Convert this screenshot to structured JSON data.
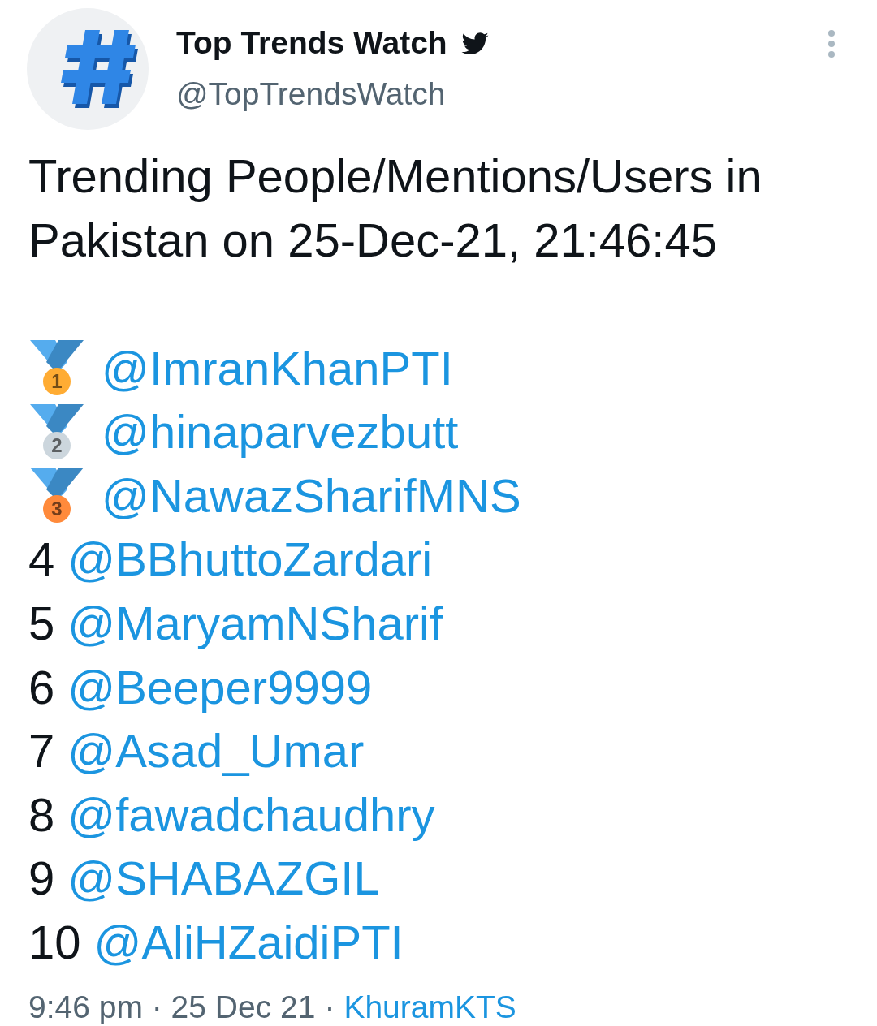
{
  "account": {
    "name": "Top Trends Watch",
    "handle": "@TopTrendsWatch"
  },
  "tweet": {
    "headline": "Trending People/Mentions/Users in Pakistan on 25-Dec-21, 21:46:45",
    "ranking": [
      {
        "kind": "medal",
        "rank": "1",
        "color": "#ffac33",
        "mention": "@ImranKhanPTI"
      },
      {
        "kind": "medal",
        "rank": "2",
        "color": "#ccd6dd",
        "mention": "@hinaparvezbutt"
      },
      {
        "kind": "medal",
        "rank": "3",
        "color": "#ff8a3b",
        "mention": "@NawazSharifMNS"
      },
      {
        "kind": "number",
        "rank": "4",
        "mention": "@BBhuttoZardari"
      },
      {
        "kind": "number",
        "rank": "5",
        "mention": "@MaryamNSharif"
      },
      {
        "kind": "number",
        "rank": "6",
        "mention": "@Beeper9999"
      },
      {
        "kind": "number",
        "rank": "7",
        "mention": "@Asad_Umar"
      },
      {
        "kind": "number",
        "rank": "8",
        "mention": "@fawadchaudhry"
      },
      {
        "kind": "number",
        "rank": "9",
        "mention": "@SHABAZGIL"
      },
      {
        "kind": "number",
        "rank": "10",
        "mention": "@AliHZaidiPTI"
      }
    ]
  },
  "footer": {
    "timestamp": "9:46 pm · 25 Dec 21",
    "separator": "·",
    "source": "KhuramKTS"
  }
}
